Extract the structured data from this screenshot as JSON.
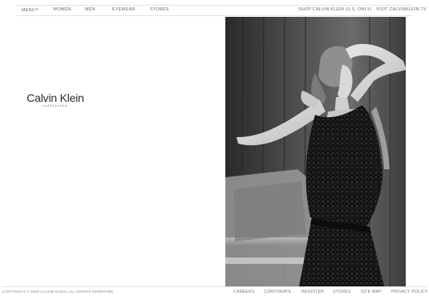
{
  "header": {
    "menu_label": "MENU",
    "nav": [
      "WOMEN",
      "MEN",
      "EYEWEAR",
      "STORES"
    ],
    "shop_link": "SHOP CALVIN KLEIN (U.S. ONLY)",
    "visit_link": "VISIT CALVINKLEIN.TV"
  },
  "brand": {
    "name": "Calvin Klein",
    "line": "collection"
  },
  "footer": {
    "copyright": "COPYRIGHT © 2009 CALVIN KLEIN. ALL RIGHTS RESERVED",
    "links": [
      "CAREERS",
      "CORPORATE",
      "REGISTER",
      "STORES",
      "SITE MAP",
      "PRIVACY POLICY"
    ]
  },
  "icons": {
    "menu_chevron": "chevron-down-icon"
  }
}
